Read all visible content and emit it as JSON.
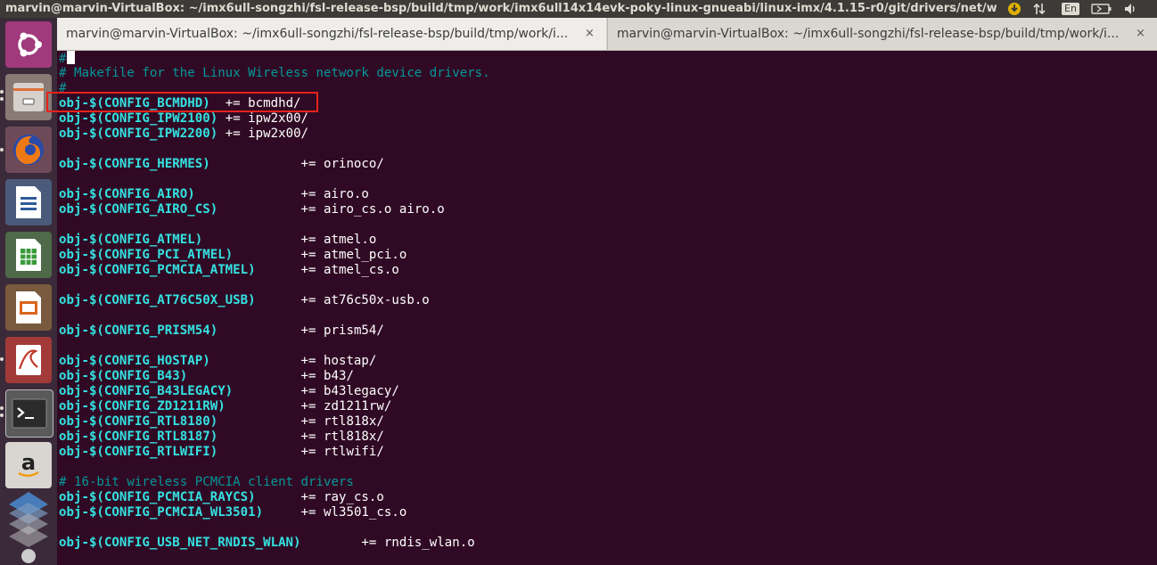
{
  "window_title": "marvin@marvin-VirtualBox: ~/imx6ull-songzhi/fsl-release-bsp/build/tmp/work/imx6ull14x14evk-poky-linux-gnueabi/linux-imx/4.1.15-r0/git/drivers/net/wi",
  "indicators": {
    "language": "En"
  },
  "tabs": [
    {
      "label": "marvin@marvin-VirtualBox: ~/imx6ull-songzhi/fsl-release-bsp/build/tmp/work/i...",
      "close": "×"
    },
    {
      "label": "marvin@marvin-VirtualBox: ~/imx6ull-songzhi/fsl-release-bsp/build/tmp/work/i...",
      "close": "×"
    }
  ],
  "launcher": [
    {
      "name": "ubuntu-dash-icon"
    },
    {
      "name": "files-icon"
    },
    {
      "name": "firefox-icon"
    },
    {
      "name": "libreoffice-writer-icon"
    },
    {
      "name": "libreoffice-calc-icon"
    },
    {
      "name": "libreoffice-impress-icon"
    },
    {
      "name": "document-viewer-icon"
    },
    {
      "name": "terminal-icon"
    },
    {
      "name": "amazon-icon"
    },
    {
      "name": "stack-icon"
    }
  ],
  "terminal": {
    "lines": [
      {
        "kind": "cursor",
        "text": "#"
      },
      {
        "kind": "comment",
        "text": "# Makefile for the Linux Wireless network device drivers."
      },
      {
        "kind": "comment",
        "text": "#"
      },
      {
        "kind": "rule",
        "var": "obj-$(CONFIG_BCMDHD)",
        "pad": "  ",
        "rhs": "+= bcmdhd/"
      },
      {
        "kind": "rule",
        "var": "obj-$(CONFIG_IPW2100)",
        "pad": " ",
        "rhs": "+= ipw2x00/"
      },
      {
        "kind": "rule",
        "var": "obj-$(CONFIG_IPW2200)",
        "pad": " ",
        "rhs": "+= ipw2x00/"
      },
      {
        "kind": "blank",
        "text": ""
      },
      {
        "kind": "rule",
        "var": "obj-$(CONFIG_HERMES)",
        "pad": "            ",
        "rhs": "+= orinoco/"
      },
      {
        "kind": "blank",
        "text": ""
      },
      {
        "kind": "rule",
        "var": "obj-$(CONFIG_AIRO)",
        "pad": "              ",
        "rhs": "+= airo.o"
      },
      {
        "kind": "rule",
        "var": "obj-$(CONFIG_AIRO_CS)",
        "pad": "           ",
        "rhs": "+= airo_cs.o airo.o"
      },
      {
        "kind": "blank",
        "text": ""
      },
      {
        "kind": "rule",
        "var": "obj-$(CONFIG_ATMEL)",
        "pad": "             ",
        "rhs": "+= atmel.o"
      },
      {
        "kind": "rule",
        "var": "obj-$(CONFIG_PCI_ATMEL)",
        "pad": "         ",
        "rhs": "+= atmel_pci.o"
      },
      {
        "kind": "rule",
        "var": "obj-$(CONFIG_PCMCIA_ATMEL)",
        "pad": "      ",
        "rhs": "+= atmel_cs.o"
      },
      {
        "kind": "blank",
        "text": ""
      },
      {
        "kind": "rule",
        "var": "obj-$(CONFIG_AT76C50X_USB)",
        "pad": "      ",
        "rhs": "+= at76c50x-usb.o"
      },
      {
        "kind": "blank",
        "text": ""
      },
      {
        "kind": "rule",
        "var": "obj-$(CONFIG_PRISM54)",
        "pad": "           ",
        "rhs": "+= prism54/"
      },
      {
        "kind": "blank",
        "text": ""
      },
      {
        "kind": "rule",
        "var": "obj-$(CONFIG_HOSTAP)",
        "pad": "            ",
        "rhs": "+= hostap/"
      },
      {
        "kind": "rule",
        "var": "obj-$(CONFIG_B43)",
        "pad": "               ",
        "rhs": "+= b43/"
      },
      {
        "kind": "rule",
        "var": "obj-$(CONFIG_B43LEGACY)",
        "pad": "         ",
        "rhs": "+= b43legacy/"
      },
      {
        "kind": "rule",
        "var": "obj-$(CONFIG_ZD1211RW)",
        "pad": "          ",
        "rhs": "+= zd1211rw/"
      },
      {
        "kind": "rule",
        "var": "obj-$(CONFIG_RTL8180)",
        "pad": "           ",
        "rhs": "+= rtl818x/"
      },
      {
        "kind": "rule",
        "var": "obj-$(CONFIG_RTL8187)",
        "pad": "           ",
        "rhs": "+= rtl818x/"
      },
      {
        "kind": "rule",
        "var": "obj-$(CONFIG_RTLWIFI)",
        "pad": "           ",
        "rhs": "+= rtlwifi/"
      },
      {
        "kind": "blank",
        "text": ""
      },
      {
        "kind": "comment",
        "text": "# 16-bit wireless PCMCIA client drivers"
      },
      {
        "kind": "rule",
        "var": "obj-$(CONFIG_PCMCIA_RAYCS)",
        "pad": "      ",
        "rhs": "+= ray_cs.o"
      },
      {
        "kind": "rule",
        "var": "obj-$(CONFIG_PCMCIA_WL3501)",
        "pad": "     ",
        "rhs": "+= wl3501_cs.o"
      },
      {
        "kind": "blank",
        "text": ""
      },
      {
        "kind": "rule",
        "var": "obj-$(CONFIG_USB_NET_RNDIS_WLAN)",
        "pad": "        ",
        "rhs": "+= rndis_wlan.o"
      }
    ]
  },
  "highlight": {
    "color": "#e8221b",
    "target_line": 3
  },
  "colors": {
    "terminal_bg": "#300a24",
    "comment": "#06989a",
    "variable": "#34e2e2",
    "text": "#ffffff",
    "topbar": "#3c3b37",
    "launcher_bg": "#3b2b3a"
  }
}
